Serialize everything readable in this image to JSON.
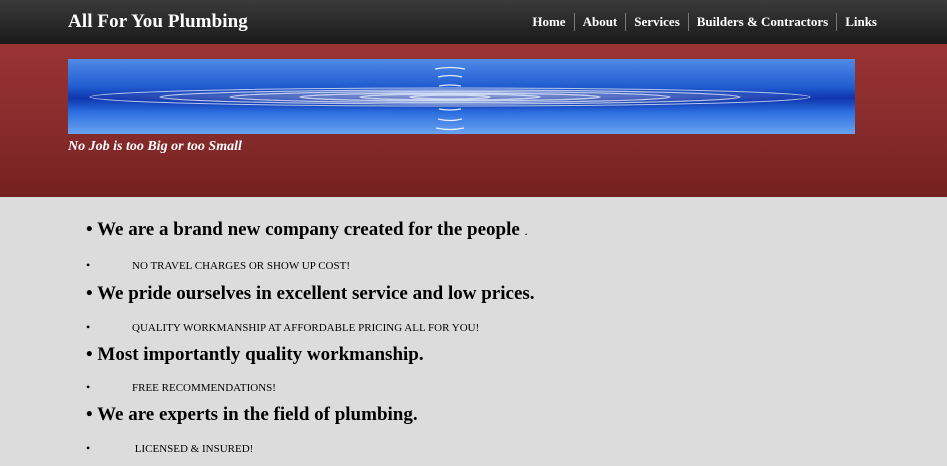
{
  "site": {
    "title": "All For You Plumbing",
    "tagline": "No Job is too Big or too Small"
  },
  "nav": {
    "items": [
      {
        "label": "Home"
      },
      {
        "label": "About"
      },
      {
        "label": "Services"
      },
      {
        "label": "Builders & Contractors"
      },
      {
        "label": "Links"
      }
    ]
  },
  "banner": {
    "image_description": "water-ripple-icon"
  },
  "content": {
    "bullet_symbol": "•",
    "headlines": [
      {
        "text": "We are a brand new company created for the people",
        "trail": "."
      },
      {
        "text": "We pride ourselves in excellent service and low prices.",
        "trail": ""
      },
      {
        "text": "Most importantly quality workmanship.",
        "trail": ""
      },
      {
        "text": "We are experts in the field of plumbing.",
        "trail": ""
      }
    ],
    "subpoints": [
      "NO TRAVEL CHARGES OR SHOW UP COST!",
      "QUALITY WORKMANSHIP AT AFFORDABLE PRICING ALL FOR YOU!",
      "FREE RECOMMENDATIONS!",
      " LICENSED & INSURED!"
    ]
  },
  "colors": {
    "topbar": "#222222",
    "banner": "#8a2c2d",
    "content_background": "#dcdcdc",
    "text": "#000000"
  }
}
